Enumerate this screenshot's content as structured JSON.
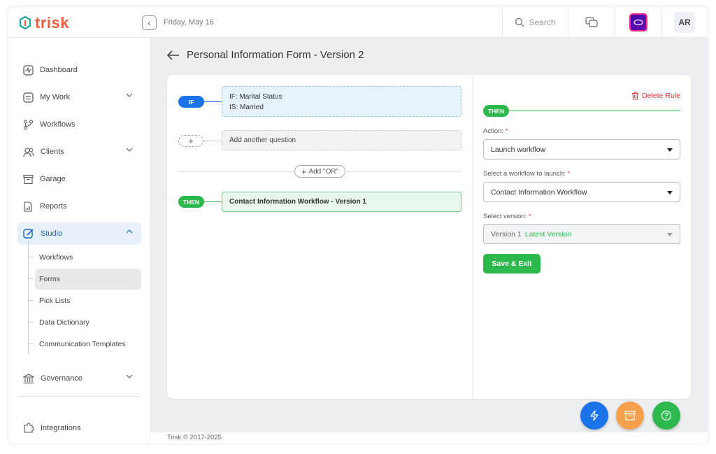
{
  "app": {
    "logo_text": "trisk",
    "brand_color": "#e8603c"
  },
  "topbar": {
    "date": "Friday, May 16",
    "search_placeholder": "Search",
    "avatar_initials": "AR"
  },
  "sidebar": {
    "items": [
      {
        "label": "Dashboard",
        "icon": "dashboard-icon"
      },
      {
        "label": "My Work",
        "icon": "my-work-icon"
      },
      {
        "label": "Workflows",
        "icon": "workflows-icon"
      },
      {
        "label": "Clients",
        "icon": "clients-icon"
      },
      {
        "label": "Garage",
        "icon": "garage-icon"
      },
      {
        "label": "Reports",
        "icon": "reports-icon"
      },
      {
        "label": "Studio",
        "icon": "studio-icon"
      },
      {
        "label": "Governance",
        "icon": "governance-icon"
      },
      {
        "label": "Integrations",
        "icon": "integrations-icon"
      }
    ],
    "studio_sub": [
      {
        "label": "Workflows"
      },
      {
        "label": "Forms"
      },
      {
        "label": "Pick Lists"
      },
      {
        "label": "Data Dictionary"
      },
      {
        "label": "Communication Templates"
      }
    ]
  },
  "page": {
    "title": "Personal Information Form - Version 2"
  },
  "rule": {
    "if_pill": "IF",
    "condition_line1": "IF: Marital Status",
    "condition_line2": "IS: Married",
    "add_question": "Add another question",
    "add_or": "Add \"OR\"",
    "then_pill": "THEN",
    "then_action": "Contact Information Workflow - Version 1"
  },
  "panel": {
    "delete_rule": "Delete Rule",
    "then_pill": "THEN",
    "action_label": "Action:",
    "action_value": "Launch workflow",
    "workflow_label": "Select a workflow to launch:",
    "workflow_value": "Contact Information Workflow",
    "version_label": "Select version:",
    "version_value": "Version 1",
    "version_tag": "Latest Version",
    "required_mark": "*",
    "save_label": "Save & Exit"
  },
  "fabs": [
    {
      "icon": "bolt-icon",
      "color": "#1a73e8"
    },
    {
      "icon": "archive-icon",
      "color": "#f5a04a"
    },
    {
      "icon": "help-icon",
      "color": "#2db84d"
    }
  ],
  "footer": {
    "text": "Trisk © 2017-2025"
  }
}
